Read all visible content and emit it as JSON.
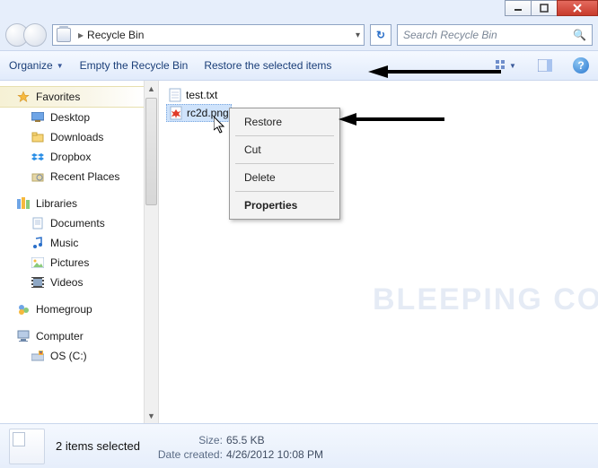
{
  "window": {
    "minimize": "minimize",
    "maximize": "maximize",
    "close": "close"
  },
  "address": {
    "location": "Recycle Bin",
    "refresh_glyph": "↻",
    "search_placeholder": "Search Recycle Bin",
    "search_glyph": "🔍"
  },
  "toolbar": {
    "organize": "Organize",
    "empty": "Empty the Recycle Bin",
    "restore": "Restore the selected items",
    "help_glyph": "?"
  },
  "sidebar": {
    "favorites": "Favorites",
    "fav_items": [
      {
        "label": "Desktop"
      },
      {
        "label": "Downloads"
      },
      {
        "label": "Dropbox"
      },
      {
        "label": "Recent Places"
      }
    ],
    "libraries": "Libraries",
    "lib_items": [
      {
        "label": "Documents"
      },
      {
        "label": "Music"
      },
      {
        "label": "Pictures"
      },
      {
        "label": "Videos"
      }
    ],
    "homegroup": "Homegroup",
    "computer": "Computer",
    "comp_items": [
      {
        "label": "OS (C:)"
      }
    ]
  },
  "files": [
    {
      "name": "test.txt",
      "type": "txt"
    },
    {
      "name": "rc2d.png",
      "type": "png",
      "selected": true
    }
  ],
  "context_menu": {
    "restore": "Restore",
    "cut": "Cut",
    "delete": "Delete",
    "properties": "Properties"
  },
  "status": {
    "selection": "2 items selected",
    "size_label": "Size:",
    "size_value": "65.5 KB",
    "date_label": "Date created:",
    "date_value": "4/26/2012 10:08 PM"
  },
  "watermark": "BLEEPING COMPUTER"
}
